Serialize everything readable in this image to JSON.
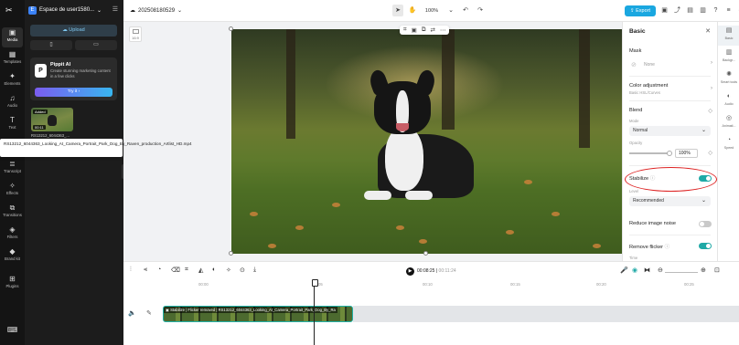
{
  "rail": {
    "items": [
      {
        "label": "Media",
        "icon": "▣"
      },
      {
        "label": "Templates",
        "icon": "▦"
      },
      {
        "label": "Elements",
        "icon": "✦"
      },
      {
        "label": "Audio",
        "icon": "♫"
      },
      {
        "label": "Text",
        "icon": "T"
      },
      {
        "label": "Captions",
        "icon": "▭"
      },
      {
        "label": "Transcript",
        "icon": "≣"
      },
      {
        "label": "Effects",
        "icon": "✧"
      },
      {
        "label": "Transitions",
        "icon": "⧉"
      },
      {
        "label": "Filters",
        "icon": "◈"
      },
      {
        "label": "Brand kit",
        "icon": "◆"
      },
      {
        "label": "Plugins",
        "icon": "⊞"
      }
    ]
  },
  "panel": {
    "workspace": "Espace de user1580...",
    "upload_label": "Upload",
    "pippit": {
      "title": "Pippit AI",
      "description": "Create stunning marketing content in a few clicks",
      "try_label": "Try it"
    },
    "media_item": {
      "added_badge": "Added",
      "duration": "00:11",
      "caption": "RS13212_6044363_..."
    },
    "tooltip": "RS13212_6044363_Looking_At_Camera_Portrait_Park_Dog_By_Raven_production_Artlist_HD.mp4"
  },
  "topbar": {
    "project_name": "202508180529",
    "zoom": "100%",
    "export_label": "Export"
  },
  "canvas": {
    "ratio_label": "16:9"
  },
  "right_panel": {
    "title": "Basic",
    "mask_label": "Mask",
    "mask_value": "None",
    "color_adjust_label": "Color adjustment",
    "color_adjust_sub": "Basic HSL/Curves",
    "blend_label": "Blend",
    "mode_label": "Mode",
    "mode_value": "Normal",
    "opacity_label": "Opacity",
    "opacity_value": "100%",
    "opacity_level": 1.0,
    "stabilize_label": "Stabilize",
    "stabilize_on": true,
    "level_label": "Level",
    "level_value": "Recommended",
    "noise_label": "Reduce image noise",
    "noise_on": false,
    "flicker_label": "Remove flicker",
    "flicker_on": true,
    "time_label": "Time"
  },
  "right_tabs": [
    {
      "label": "Basic",
      "icon": "▤"
    },
    {
      "label": "Backgr...",
      "icon": "▥"
    },
    {
      "label": "Smart tools",
      "icon": "✺"
    },
    {
      "label": "Audio",
      "icon": "◐"
    },
    {
      "label": "Animati...",
      "icon": "◎"
    },
    {
      "label": "Speed",
      "icon": "◔"
    }
  ],
  "timeline": {
    "current_time": "00:08:25",
    "total_time": "00:11:24",
    "ruler": [
      "00:00",
      "00:05",
      "00:10",
      "00:15",
      "00:20",
      "00:25",
      "00:30"
    ],
    "clip": {
      "tag1": "Stabilize",
      "tag2": "Flicker removed",
      "name": "RS13212_6044363_Looking_At_Camera_Portrait_Park_Dog_By_Ra"
    }
  },
  "colors": {
    "accent": "#1aa7e0",
    "toggle_on": "#1fa9a6",
    "clip_border": "#21b0a5",
    "annotation": "#dd2222"
  }
}
